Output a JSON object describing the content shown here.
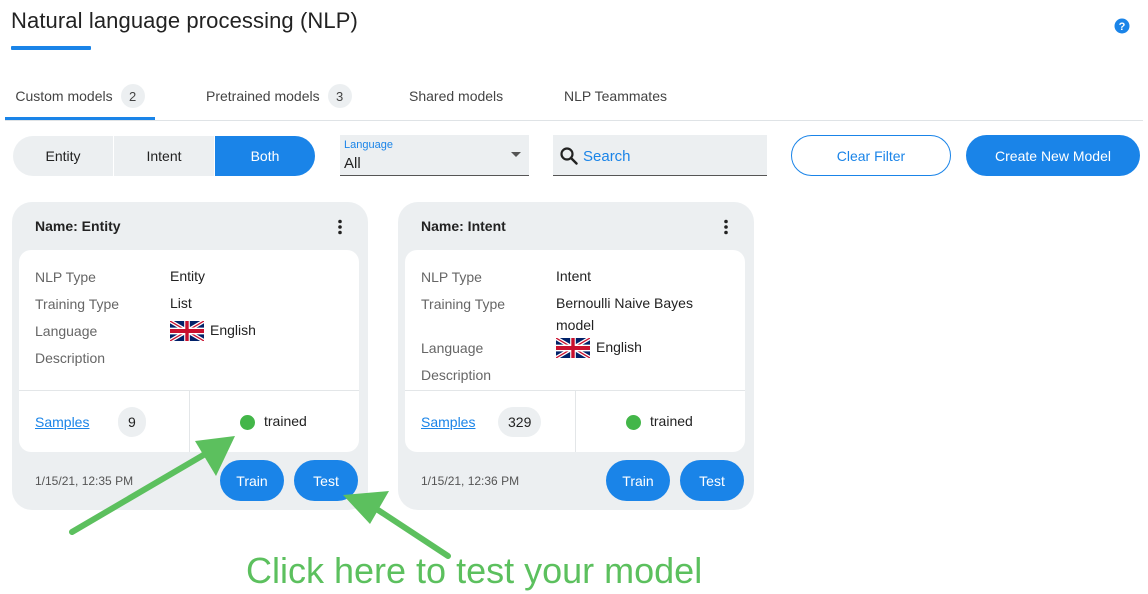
{
  "page": {
    "title": "Natural language processing (NLP)"
  },
  "tabs": [
    {
      "label": "Custom models",
      "count": "2"
    },
    {
      "label": "Pretrained models",
      "count": "3"
    },
    {
      "label": "Shared models"
    },
    {
      "label": "NLP Teammates"
    }
  ],
  "filters": {
    "type_segments": [
      "Entity",
      "Intent",
      "Both"
    ],
    "selected_segment": "Both",
    "language": {
      "label": "Language",
      "value": "All"
    },
    "search": {
      "placeholder": "Search"
    },
    "clear_label": "Clear Filter",
    "create_label": "Create New Model"
  },
  "field_labels": {
    "nlp_type": "NLP Type",
    "training_type": "Training Type",
    "language": "Language",
    "description": "Description",
    "samples": "Samples",
    "train": "Train",
    "test": "Test"
  },
  "models": [
    {
      "name": "Name: Entity",
      "nlp_type": "Entity",
      "training_type": "List",
      "language": "English",
      "samples": "9",
      "status": "trained",
      "date": "1/15/21, 12:35 PM"
    },
    {
      "name": "Name: Intent",
      "nlp_type": "Intent",
      "training_type_line1": "Bernoulli Naive Bayes",
      "training_type_line2": "model",
      "language": "English",
      "samples": "329",
      "status": "trained",
      "date": "1/15/21, 12:36 PM"
    }
  ],
  "annotation": {
    "text": "Click here to test your model"
  },
  "colors": {
    "accent": "#1a84e8",
    "trained": "#43b649",
    "annotation": "#5cc05e",
    "panel": "#eceff1"
  },
  "icons": [
    "help-icon",
    "search-icon",
    "kebab-menu-icon",
    "uk-flag-icon",
    "chevron-down-icon"
  ]
}
